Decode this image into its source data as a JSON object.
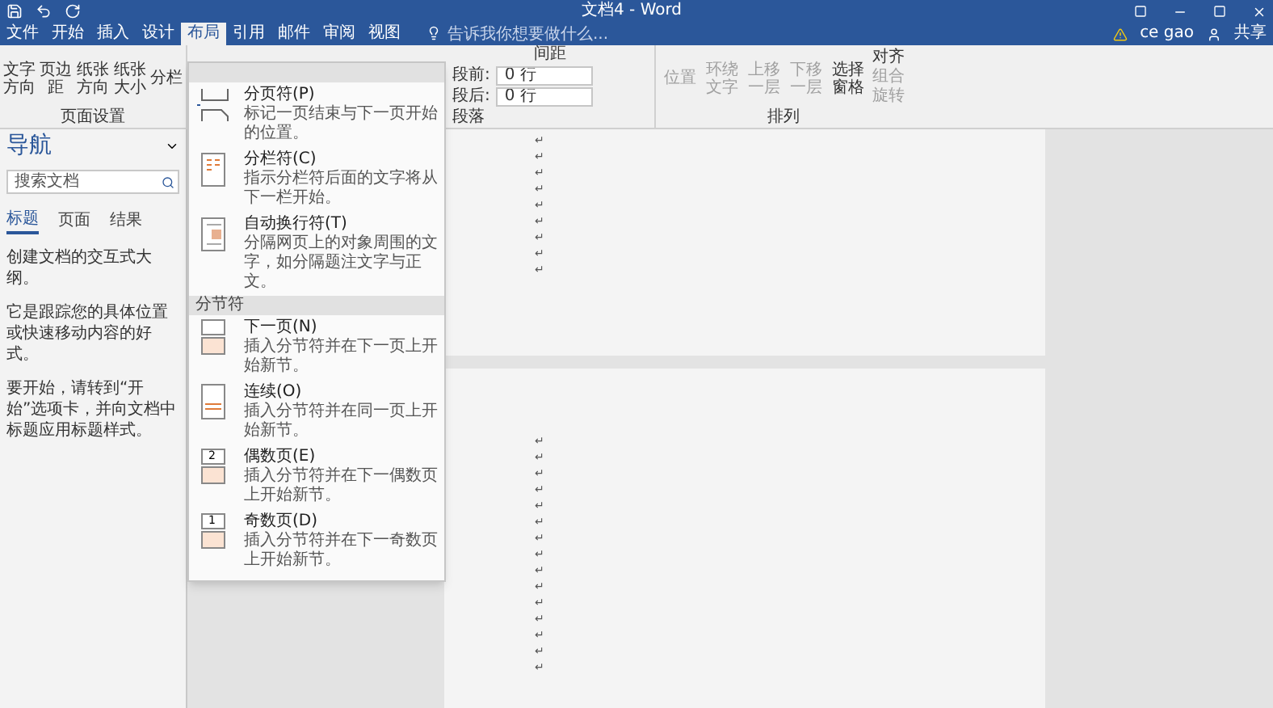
{
  "window": {
    "title": "文档4 - Word",
    "user": "ce gao",
    "share": "共享"
  },
  "ribbon_tabs": [
    {
      "label": "文件",
      "selected": false
    },
    {
      "label": "开始",
      "selected": false
    },
    {
      "label": "插入",
      "selected": false
    },
    {
      "label": "设计",
      "selected": false
    },
    {
      "label": "布局",
      "selected": true
    },
    {
      "label": "引用",
      "selected": false
    },
    {
      "label": "邮件",
      "selected": false
    },
    {
      "label": "审阅",
      "selected": false
    },
    {
      "label": "视图",
      "selected": false
    }
  ],
  "tell_me": {
    "placeholder": "告诉我你想要做什么..."
  },
  "page_setup": {
    "buttons": [
      "文字方向",
      "页边距",
      "纸张方向",
      "纸张大小",
      "分栏"
    ],
    "label": "页面设置"
  },
  "paragraph": {
    "title": "间距",
    "before_label": "段前:",
    "before_value": "0 行",
    "after_label": "段后:",
    "after_value": "0 行",
    "label": "段落"
  },
  "arrange": {
    "buttons": [
      {
        "label": "位置",
        "disabled": true
      },
      {
        "label": "环绕文字",
        "disabled": true
      },
      {
        "label": "上移一层",
        "disabled": true
      },
      {
        "label": "下移一层",
        "disabled": true
      },
      {
        "label": "选择窗格",
        "disabled": false
      }
    ],
    "small": [
      {
        "label": "对齐",
        "disabled": false
      },
      {
        "label": "组合",
        "disabled": true
      },
      {
        "label": "旋转",
        "disabled": true
      }
    ],
    "label": "排列"
  },
  "navigation": {
    "title": "导航",
    "search": {
      "placeholder": "搜索文档"
    },
    "tabs": [
      {
        "label": "标题",
        "selected": true
      },
      {
        "label": "页面",
        "selected": false
      },
      {
        "label": "结果",
        "selected": false
      }
    ],
    "paragraphs": [
      "创建文档的交互式大纲。",
      "它是跟踪您的具体位置或快速移动内容的好式。",
      "要开始，请转到“开始”选项卡，并向文档中标题应用标题样式。"
    ]
  },
  "breaks_menu": {
    "sections": [
      {
        "items": [
          {
            "kind": "page",
            "title": "分页符(P)",
            "description": "标记一页结束与下一页开始的位置。"
          },
          {
            "kind": "column",
            "title": "分栏符(C)",
            "description": "指示分栏符后面的文字将从下一栏开始。"
          },
          {
            "kind": "wrap",
            "title": "自动换行符(T)",
            "description": "分隔网页上的对象周围的文字，如分隔题注文字与正文。"
          }
        ]
      },
      {
        "heading": "分节符",
        "items": [
          {
            "kind": "next",
            "title": "下一页(N)",
            "description": "插入分节符并在下一页上开始新节。"
          },
          {
            "kind": "continuous",
            "title": "连续(O)",
            "description": "插入分节符并在同一页上开始新节。"
          },
          {
            "kind": "even",
            "title": "偶数页(E)",
            "description": "插入分节符并在下一偶数页上开始新节。",
            "number": "2"
          },
          {
            "kind": "odd",
            "title": "奇数页(D)",
            "description": "插入分节符并在下一奇数页上开始新节。",
            "number": "1"
          }
        ]
      }
    ]
  },
  "pages": [
    {
      "marks": [
        "↵",
        "↵",
        "↵",
        "↵",
        "↵",
        "↵",
        "↵",
        "↵",
        "↵"
      ]
    },
    {
      "marks": [
        "↵",
        "↵",
        "↵",
        "↵",
        "↵",
        "↵",
        "↵",
        "↵",
        "↵",
        "↵",
        "↵",
        "↵",
        "↵",
        "↵",
        "↵"
      ]
    }
  ]
}
